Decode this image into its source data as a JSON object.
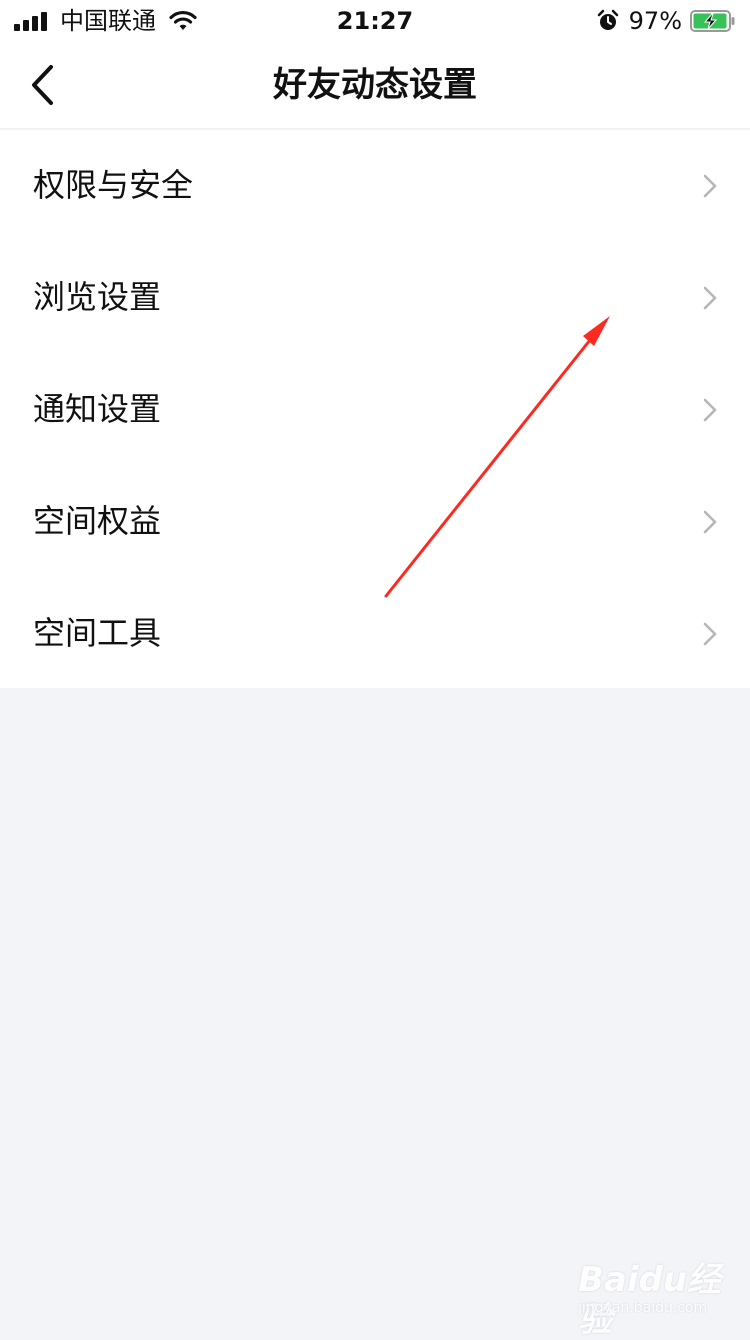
{
  "status_bar": {
    "carrier": "中国联通",
    "time": "21:27",
    "battery_percent": "97%",
    "battery_level": 0.97,
    "charging": true,
    "battery_color": "#38c159"
  },
  "navbar": {
    "title": "好友动态设置",
    "back_icon": "chevron-left-icon"
  },
  "menu": {
    "items": [
      {
        "label": "权限与安全",
        "icon": "chevron-right-icon"
      },
      {
        "label": "浏览设置",
        "icon": "chevron-right-icon"
      },
      {
        "label": "通知设置",
        "icon": "chevron-right-icon"
      },
      {
        "label": "空间权益",
        "icon": "chevron-right-icon"
      },
      {
        "label": "空间工具",
        "icon": "chevron-right-icon"
      }
    ]
  },
  "annotation": {
    "color": "#ff2a1f"
  },
  "watermark": {
    "brand": "Baidu经验",
    "url": "jingyan.baidu.com"
  }
}
